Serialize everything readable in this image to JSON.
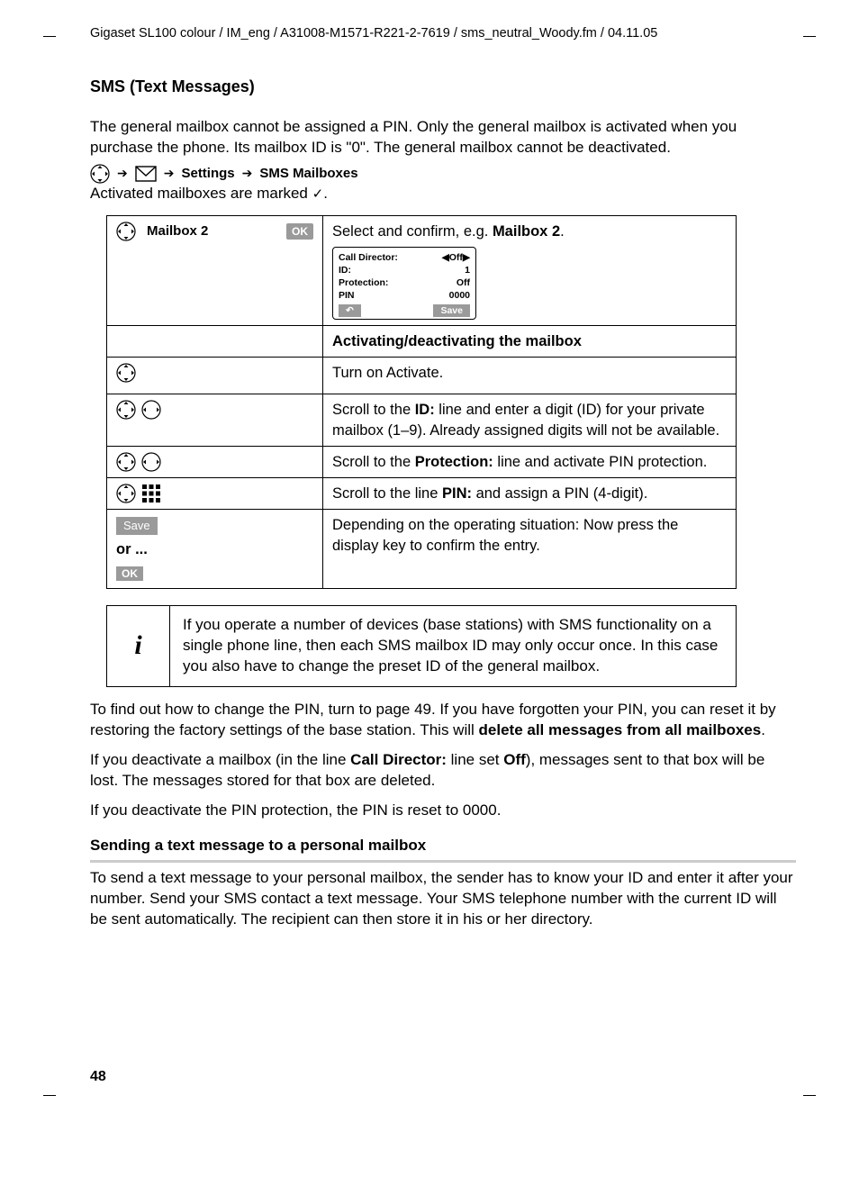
{
  "header": "Gigaset SL100 colour / IM_eng / A31008-M1571-R221-2-7619 / sms_neutral_Woody.fm / 04.11.05",
  "title": "SMS (Text Messages)",
  "intro": "The general mailbox cannot be assigned a PIN. Only the general mailbox is activated when you purchase the phone. Its mailbox ID is \"0\". The general mailbox cannot be deactivated.",
  "navpath": {
    "settings": "Settings",
    "mailboxes": "SMS Mailboxes"
  },
  "activated_note": "Activated mailboxes are marked ",
  "check": "✓",
  "table": {
    "mailbox_label": "Mailbox 2",
    "ok": "OK",
    "select_confirm_pre": "Select and confirm, e.g. ",
    "select_confirm_bold": "Mailbox 2",
    "mini": {
      "r1l": "Call Director:",
      "r1r": "◀Off▶",
      "r2l": "ID:",
      "r2r": "1",
      "r3l": "Protection:",
      "r3r": "Off",
      "r4l": "PIN",
      "r4r": "0000",
      "back": "↶",
      "save": "Save"
    },
    "activating_header": "Activating/deactivating the mailbox",
    "turn_on": "Turn on Activate.",
    "scroll_id_pre": "Scroll to the ",
    "scroll_id_bold": "ID:",
    "scroll_id_post": " line and enter a digit (ID) for your private mailbox (1–9). Already assigned digits will not be available.",
    "scroll_prot_pre": "Scroll to the ",
    "scroll_prot_bold": "Protection:",
    "scroll_prot_post": " line and activate PIN protection.",
    "scroll_pin_pre": "Scroll to the line ",
    "scroll_pin_bold": "PIN:",
    "scroll_pin_post": " and assign a PIN (4-digit).",
    "save": "Save",
    "or": "or ...",
    "depending": "Depending on the operating situation: Now press the display key to confirm the entry."
  },
  "info_note": "If you operate a number of devices (base stations) with SMS functionality on a single phone line, then each SMS mailbox ID may only occur once. In this case you also have to change the preset ID of the general mailbox.",
  "info_i": "i",
  "p1_pre": "To find out how to change the PIN, turn to page 49. If you have forgotten your PIN, you can reset it by restoring the factory settings of the base station. This will ",
  "p1_bold": "delete all messages from all mailboxes",
  "p1_post": ".",
  "p2_pre": "If you deactivate a mailbox (in the line ",
  "p2_b1": "Call Director:",
  "p2_mid": " line set ",
  "p2_b2": "Off",
  "p2_post": "), messages sent to that box will be lost. The messages stored for that box are deleted.",
  "p3": "If you deactivate the PIN protection, the PIN is reset to 0000.",
  "sub2": "Sending a text message to a personal mailbox",
  "p4": "To send a text message to your personal mailbox, the sender has to know your ID and enter it after your number. Send your SMS contact a text message. Your SMS telephone number with the current ID will be sent automatically. The recipient can then store it in his or her directory.",
  "pagenum": "48"
}
